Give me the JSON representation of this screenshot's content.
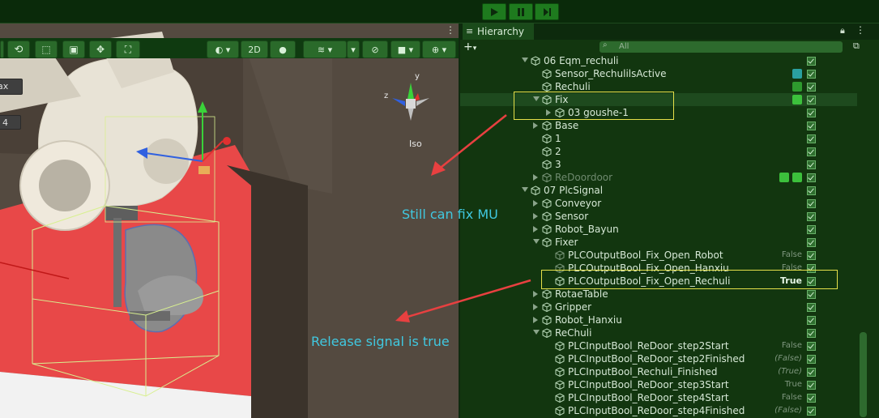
{
  "playbar": {
    "play": "play-icon",
    "pause": "pause-icon",
    "step": "step-icon"
  },
  "scene_toolbar": {
    "mode_2d": "2D",
    "left_fields": [
      "ax",
      "4"
    ]
  },
  "gizmo": {
    "axis_z": "z",
    "axis_y": "y",
    "projection": "Iso"
  },
  "hierarchy": {
    "tab_title": "Hierarchy",
    "search_placeholder": "All",
    "rows": [
      {
        "label": "06 Eqm_rechuli",
        "indent": 0,
        "arrow": "down"
      },
      {
        "label": "Sensor_RechulilsActive",
        "indent": 1,
        "arrow": "none"
      },
      {
        "label": "Rechuli",
        "indent": 1,
        "arrow": "none"
      },
      {
        "label": "Fix",
        "indent": 1,
        "arrow": "down"
      },
      {
        "label": "03 goushe-1",
        "indent": 2,
        "arrow": "right"
      },
      {
        "label": "Base",
        "indent": 1,
        "arrow": "right"
      },
      {
        "label": "1",
        "indent": 1,
        "arrow": "none"
      },
      {
        "label": "2",
        "indent": 1,
        "arrow": "none"
      },
      {
        "label": "3",
        "indent": 1,
        "arrow": "none"
      },
      {
        "label": "ReDoordoor",
        "indent": 1,
        "arrow": "right",
        "dim": true
      },
      {
        "label": "07 PlcSignal",
        "indent": 0,
        "arrow": "down"
      },
      {
        "label": "Conveyor",
        "indent": 1,
        "arrow": "right"
      },
      {
        "label": "Sensor",
        "indent": 1,
        "arrow": "right"
      },
      {
        "label": "Robot_Bayun",
        "indent": 1,
        "arrow": "right"
      },
      {
        "label": "Fixer",
        "indent": 1,
        "arrow": "down"
      },
      {
        "label": "PLCOutputBool_Fix_Open_Robot",
        "indent": 2,
        "arrow": "none",
        "value": "False",
        "dim": true
      },
      {
        "label": "PLCOutputBool_Fix_Open_Hanxiu",
        "indent": 2,
        "arrow": "none",
        "value": "False",
        "dim": true
      },
      {
        "label": "PLCOutputBool_Fix_Open_Rechuli",
        "indent": 2,
        "arrow": "none",
        "value": "True",
        "strong": true
      },
      {
        "label": "RotaeTable",
        "indent": 1,
        "arrow": "right"
      },
      {
        "label": "Gripper",
        "indent": 1,
        "arrow": "right"
      },
      {
        "label": "Robot_Hanxiu",
        "indent": 1,
        "arrow": "right"
      },
      {
        "label": "ReChuli",
        "indent": 1,
        "arrow": "down"
      },
      {
        "label": "PLCInputBool_ReDoor_step2Start",
        "indent": 2,
        "arrow": "none",
        "value": "False"
      },
      {
        "label": "PLCInputBool_ReDoor_step2Finished",
        "indent": 2,
        "arrow": "none",
        "value": "(False)",
        "italic": true
      },
      {
        "label": "PLCInputBool_Rechuli_Finished",
        "indent": 2,
        "arrow": "none",
        "value": "(True)",
        "italic": true
      },
      {
        "label": "PLCInputBool_ReDoor_step3Start",
        "indent": 2,
        "arrow": "none",
        "value": "True"
      },
      {
        "label": "PLCInputBool_ReDoor_step4Start",
        "indent": 2,
        "arrow": "none",
        "value": "False"
      },
      {
        "label": "PLCInputBool_ReDoor_step4Finished",
        "indent": 2,
        "arrow": "none",
        "value": "(False)",
        "italic": true
      }
    ]
  },
  "annotations": {
    "fix": "Still can fix MU",
    "release": "Release signal is true"
  }
}
